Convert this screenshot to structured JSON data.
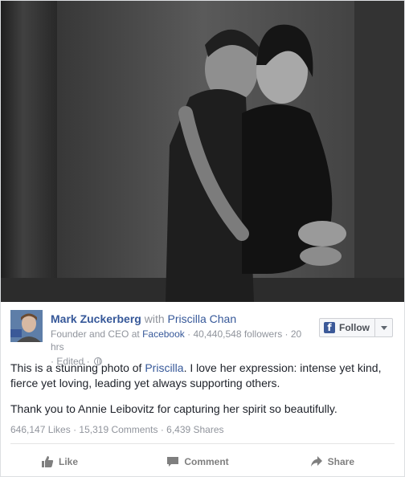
{
  "post": {
    "author_name": "Mark Zuckerberg",
    "with_text": "with",
    "tagged_name": "Priscilla Chan",
    "author_title": "Founder and CEO at",
    "company": "Facebook",
    "followers": "· 40,440,548 followers · 20 hrs",
    "edited": "· Edited ·",
    "follow_label": "Follow",
    "body_p1_a": "This is a stunning photo of ",
    "body_p1_mention": "Priscilla",
    "body_p1_b": ". I love her expression: intense yet kind, fierce yet loving, leading yet always supporting others.",
    "body_p2": "Thank you to Annie Leibovitz for capturing her spirit so beautifully."
  },
  "stats": {
    "likes": "646,147 Likes",
    "comments": "· 15,319 Comments",
    "shares": "· 6,439 Shares"
  },
  "actions": {
    "like": "Like",
    "comment": "Comment",
    "share": "Share"
  },
  "colors": {
    "link": "#365899",
    "meta_gray": "#90949c",
    "facebook_blue": "#3b5998"
  },
  "icons": [
    "facebook-f-icon",
    "caret-down-icon",
    "globe-icon",
    "thumbs-up-icon",
    "comment-icon",
    "share-arrow-icon"
  ]
}
